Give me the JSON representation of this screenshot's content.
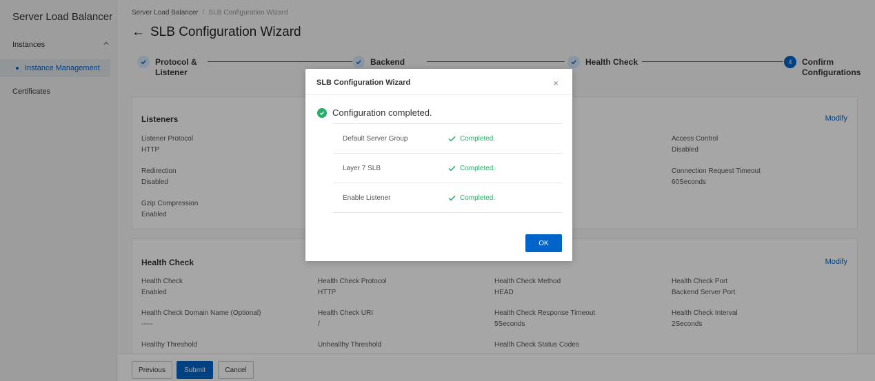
{
  "sidebar": {
    "product_title": "Server Load Balancer",
    "group_label": "Instances",
    "active_item": "Instance Management",
    "certificates": "Certificates"
  },
  "breadcrumb": {
    "root": "Server Load Balancer",
    "separator": "/",
    "current": "SLB Configuration Wizard"
  },
  "page_title": "SLB Configuration Wizard",
  "back_icon": "←",
  "steps": [
    {
      "label_line1": "Protocol &",
      "label_line2": "Listener",
      "state": "done"
    },
    {
      "label_line1": "Backend",
      "label_line2": "",
      "state": "done"
    },
    {
      "label_line1": "Health Check",
      "label_line2": "",
      "state": "done"
    },
    {
      "number": "4",
      "label_line1": "Confirm",
      "label_line2": "Configurations",
      "state": "active"
    }
  ],
  "listeners_card": {
    "title": "Listeners",
    "modify": "Modify",
    "fields": [
      {
        "key": "Listener Protocol",
        "value": "HTTP"
      },
      {
        "key": "Redirection",
        "value": "Disabled"
      },
      {
        "key": "Gzip Compression",
        "value": "Enabled"
      },
      {
        "key": "Access Control",
        "value": "Disabled"
      },
      {
        "key": "Connection Request Timeout",
        "value": "60Seconds"
      }
    ]
  },
  "health_card": {
    "title": "Health Check",
    "modify": "Modify",
    "fields": [
      {
        "key": "Health Check",
        "value": "Enabled"
      },
      {
        "key": "Health Check Protocol",
        "value": "HTTP"
      },
      {
        "key": "Health Check Method",
        "value": "HEAD"
      },
      {
        "key": "Health Check Port",
        "value": "Backend Server Port"
      },
      {
        "key": "Health Check Domain Name (Optional)",
        "value": "-----"
      },
      {
        "key": "Health Check URI",
        "value": "/"
      },
      {
        "key": "Health Check Response Timeout",
        "value": "5Seconds"
      },
      {
        "key": "Health Check Interval",
        "value": "2Seconds"
      },
      {
        "key": "Healthy Threshold",
        "value": ""
      },
      {
        "key": "Unhealthy Threshold",
        "value": ""
      },
      {
        "key": "Health Check Status Codes",
        "value": ""
      }
    ]
  },
  "footer": {
    "previous": "Previous",
    "submit": "Submit",
    "cancel": "Cancel"
  },
  "modal": {
    "title": "SLB Configuration Wizard",
    "close": "×",
    "status": "Configuration completed.",
    "rows": [
      {
        "name": "Default Server Group",
        "state": "Completed."
      },
      {
        "name": "Layer 7 SLB",
        "state": "Completed."
      },
      {
        "name": "Enable Listener",
        "state": "Completed."
      }
    ],
    "ok": "OK"
  },
  "colors": {
    "primary": "#0064c8",
    "success": "#23b066"
  }
}
